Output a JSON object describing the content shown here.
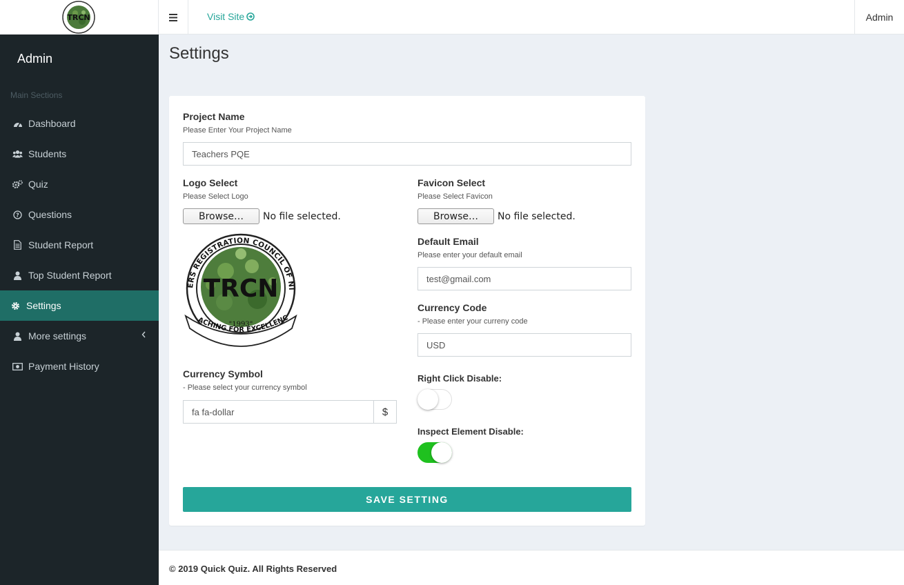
{
  "brand": {
    "logo_text": "TRCN",
    "seal_top_text": "TEACHERS REGISTRATION COUNCIL OF NIGERIA",
    "seal_year": "\"1993\"",
    "seal_motto": "TEACHING FOR EXCELLENCE"
  },
  "header": {
    "visit_site": "Visit Site",
    "user": "Admin"
  },
  "sidebar": {
    "user": "Admin",
    "section": "Main Sections",
    "items": [
      {
        "label": "Dashboard",
        "icon": "dashboard-icon"
      },
      {
        "label": "Students",
        "icon": "users-icon"
      },
      {
        "label": "Quiz",
        "icon": "cogs-icon"
      },
      {
        "label": "Questions",
        "icon": "question-circle-icon"
      },
      {
        "label": "Student Report",
        "icon": "file-text-icon"
      },
      {
        "label": "Top Student Report",
        "icon": "user-icon"
      },
      {
        "label": "Settings",
        "icon": "gear-icon"
      },
      {
        "label": "More settings",
        "icon": "user-icon"
      },
      {
        "label": "Payment History",
        "icon": "money-icon"
      }
    ],
    "active_color": "#1f6e66"
  },
  "page": {
    "title": "Settings"
  },
  "form": {
    "project_name": {
      "label": "Project Name",
      "help": "Please Enter Your Project Name",
      "value": "Teachers PQE"
    },
    "logo": {
      "label": "Logo Select",
      "help": "Please Select Logo",
      "button": "Browse…",
      "status": "No file selected."
    },
    "favicon": {
      "label": "Favicon Select",
      "help": "Please Select Favicon",
      "button": "Browse…",
      "status": "No file selected."
    },
    "default_email": {
      "label": "Default Email",
      "help": "Please enter your default email",
      "value": "test@gmail.com"
    },
    "currency_code": {
      "label": "Currency Code",
      "help": "- Please enter your curreny code",
      "value": "USD"
    },
    "currency_symbol": {
      "label": "Currency Symbol",
      "help": "- Please select your currency symbol",
      "value": "fa fa-dollar",
      "addon": "$"
    },
    "right_click": {
      "label": "Right Click Disable:",
      "enabled": false
    },
    "inspect_element": {
      "label": "Inspect Element Disable:",
      "enabled": true
    },
    "save_button": "SAVE SETTING"
  },
  "footer": {
    "text": "© 2019 Quick Quiz. All Rights Reserved"
  },
  "colors": {
    "accent": "#26a69a",
    "sidebar_bg": "#1c2529",
    "toggle_on": "#1fc11f"
  }
}
